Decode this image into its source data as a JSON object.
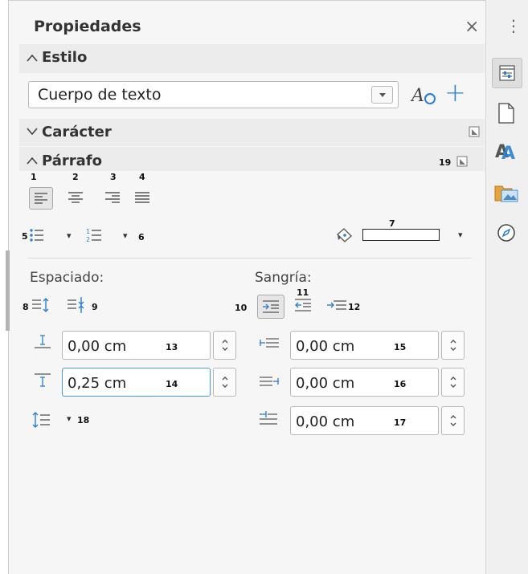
{
  "panel": {
    "title": "Propiedades",
    "close_glyph": "×",
    "menu_glyph": "⋮"
  },
  "estilo": {
    "header": "Estilo",
    "chevron": "^",
    "style_value": "Cuerpo de texto",
    "dropdown_glyph": "▾",
    "update_icon": "update-style-icon",
    "add_glyph": "+"
  },
  "caracter": {
    "header": "Carácter",
    "chevron": "v"
  },
  "parrafo": {
    "header": "Párrafo",
    "chevron": "^",
    "more_num": "19",
    "align_nums": [
      "1",
      "2",
      "3",
      "4"
    ],
    "list_nums": {
      "bullets": "5",
      "numbering": "6"
    },
    "background_num": "7",
    "dropdown_glyph": "▾"
  },
  "espaciado": {
    "label": "Espaciado:",
    "nums": {
      "increase": "8",
      "decrease": "9"
    },
    "above": {
      "value": "0,00 cm",
      "num": "13"
    },
    "below": {
      "value": "0,25 cm",
      "num": "14"
    },
    "line_spacing_num": "18"
  },
  "sangria": {
    "label": "Sangría:",
    "nums": {
      "increase": "10",
      "decrease": "11",
      "hanging": "12"
    },
    "before": {
      "value": "0,00 cm",
      "num": "15"
    },
    "after": {
      "value": "0,00 cm",
      "num": "16"
    },
    "first_line": {
      "value": "0,00 cm",
      "num": "17"
    }
  },
  "tabbar": {
    "items": [
      "properties-icon",
      "page-icon",
      "styles-icon",
      "gallery-icon",
      "navigator-icon"
    ]
  },
  "colors": {
    "accent_blue": "#2a7fd4",
    "focus_border": "#4a9be0",
    "text_dark": "#333333"
  }
}
